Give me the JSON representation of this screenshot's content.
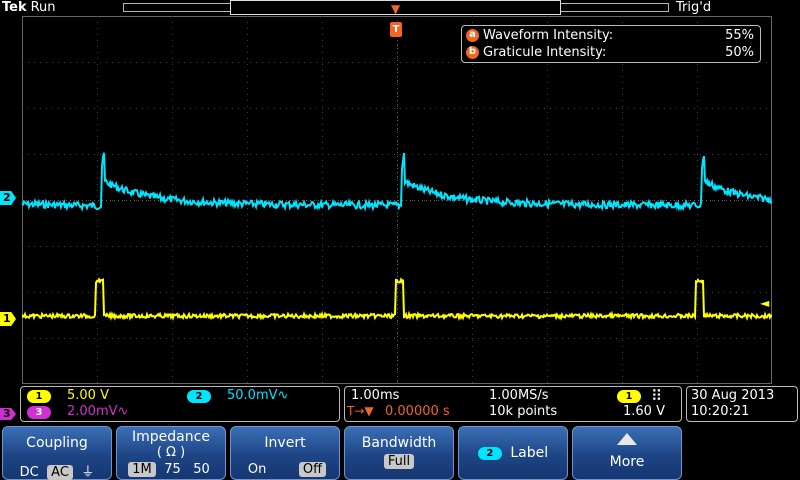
{
  "header": {
    "brand": "Tek",
    "run_state": "Run",
    "trigger_state": "Trig'd"
  },
  "trigger_marker": {
    "label": "T",
    "level_arrow": "◄"
  },
  "intensity": {
    "waveform": {
      "badge": "a",
      "label": "Waveform Intensity:",
      "value": "55%"
    },
    "graticule": {
      "badge": "b",
      "label": "Graticule Intensity:",
      "value": "50%"
    }
  },
  "channel_markers": {
    "ch2": "2",
    "ch1": "1",
    "ch3": "3"
  },
  "vertical": {
    "ch1": {
      "badge": "1",
      "scale": "5.00 V",
      "color": "#ffff00"
    },
    "ch2": {
      "badge": "2",
      "scale": "50.0mV∿",
      "color": "#00e5ff"
    },
    "ch3": {
      "badge": "3",
      "scale": "2.00mV∿",
      "color": "#d12fd1"
    }
  },
  "horizontal": {
    "timebase": "1.00ms",
    "sample_rate": "1.00MS/s",
    "trigger_source": "1",
    "trigger_slope_icon": "rising-edge-icon",
    "position_prefix": "T→▼",
    "position": "0.00000 s",
    "record_length": "10k points",
    "trigger_level": "1.60 V"
  },
  "datetime": {
    "date": "30 Aug 2013",
    "time": "10:20:21"
  },
  "menu": {
    "coupling": {
      "title": "Coupling",
      "options": [
        "DC",
        "AC",
        "⏚"
      ],
      "selected": "AC"
    },
    "impedance": {
      "title": "Impedance",
      "subtitle": "( Ω )",
      "options": [
        "1M",
        "75",
        "50"
      ],
      "selected": "1M"
    },
    "invert": {
      "title": "Invert",
      "options": [
        "On",
        "Off"
      ],
      "selected": "Off"
    },
    "bandwidth": {
      "title": "Bandwidth",
      "value": "Full"
    },
    "label": {
      "badge": "2",
      "title": "Label"
    },
    "more": {
      "title": "More",
      "icon": "up-arrow-icon"
    }
  },
  "colors": {
    "ch1": "#ffff00",
    "ch2": "#00e5ff",
    "ch3": "#d12fd1",
    "trigger": "#f26522",
    "menu_blue": "#1d4585"
  }
}
